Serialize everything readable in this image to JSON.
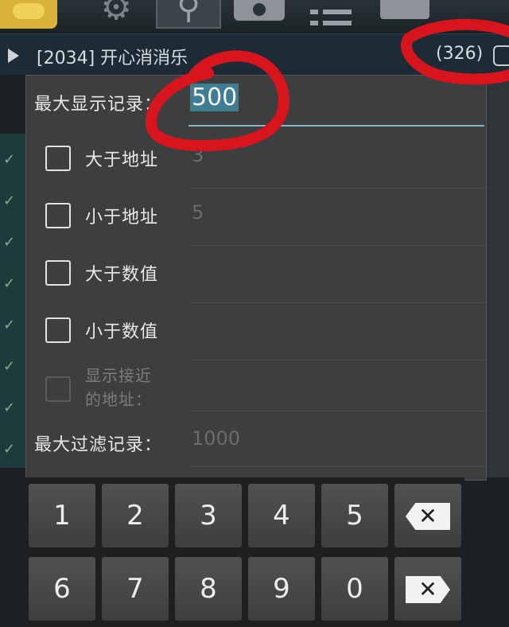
{
  "toolbar": {
    "icons": [
      "app-icon",
      "gear-icon",
      "search-icon",
      "save-icon",
      "list-icon",
      "android-icon"
    ]
  },
  "process": {
    "name": "[2034] 开心消消乐",
    "count": "(326)"
  },
  "dialog": {
    "max_display_label": "最大显示记录：",
    "max_display_value": "500",
    "greater_addr_label": "大于地址",
    "greater_addr_value": "3",
    "less_addr_label": "小于地址",
    "less_addr_value": "5",
    "greater_value_label": "大于数值",
    "less_value_label": "小于数值",
    "show_near_label_1": "显示接近",
    "show_near_label_2": "的地址：",
    "max_filter_label": "最大过滤记录：",
    "max_filter_value": "1000"
  },
  "keypad": {
    "k1": "1",
    "k2": "2",
    "k3": "3",
    "k4": "4",
    "k5": "5",
    "k6": "6",
    "k7": "7",
    "k8": "8",
    "k9": "9",
    "k0": "0",
    "backspace_glyph": "✕",
    "delete_glyph": "✕"
  },
  "colors": {
    "highlight": "#3f7d92",
    "annotation": "#d8141c"
  }
}
